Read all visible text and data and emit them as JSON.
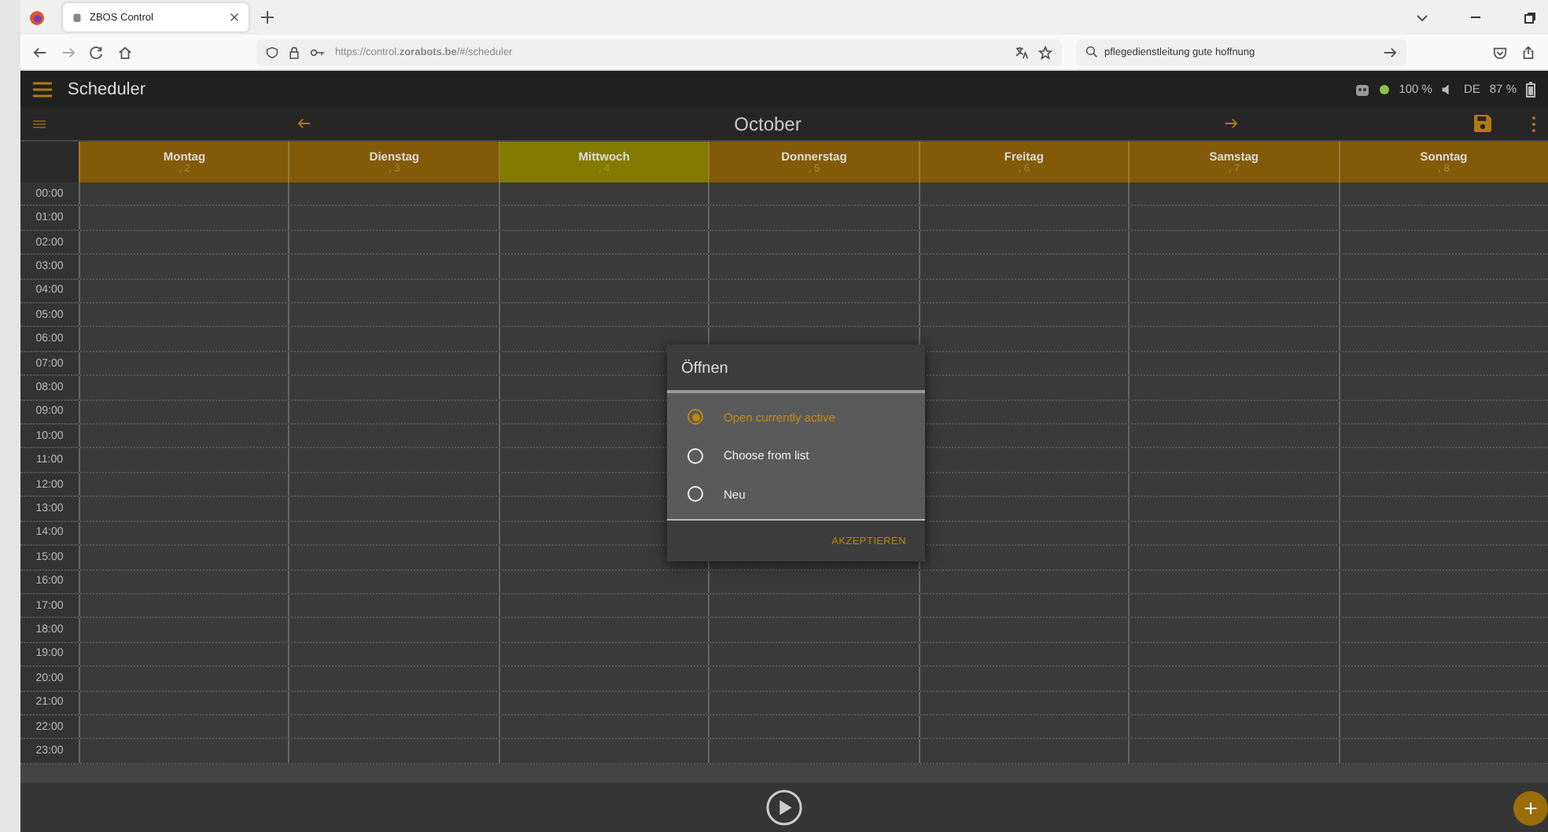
{
  "browser": {
    "tab_title": "ZBOS Control",
    "url": "https://control.**zorabots.be**/#/scheduler",
    "search": "pflegedienstleitung gute hoffnung"
  },
  "app": {
    "title": "Scheduler",
    "status": {
      "volume": "100 %",
      "language": "DE",
      "battery": "87 %"
    }
  },
  "calendar": {
    "month": "October",
    "days": [
      {
        "name": "Montag",
        "date": ", 2",
        "selected": false
      },
      {
        "name": "Dienstag",
        "date": ", 3",
        "selected": false
      },
      {
        "name": "Mittwoch",
        "date": ", 4",
        "selected": true
      },
      {
        "name": "Donnerstag",
        "date": ", 5",
        "selected": false
      },
      {
        "name": "Freitag",
        "date": ", 6",
        "selected": false
      },
      {
        "name": "Samstag",
        "date": ", 7",
        "selected": false
      },
      {
        "name": "Sonntag",
        "date": ", 8",
        "selected": false
      }
    ],
    "hours": [
      "00:00",
      "01:00",
      "02:00",
      "03:00",
      "04:00",
      "05:00",
      "06:00",
      "07:00",
      "08:00",
      "09:00",
      "10:00",
      "11:00",
      "12:00",
      "13:00",
      "14:00",
      "15:00",
      "16:00",
      "17:00",
      "18:00",
      "19:00",
      "20:00",
      "21:00",
      "22:00",
      "23:00"
    ]
  },
  "dialog": {
    "title": "Öffnen",
    "options": [
      {
        "label": "Open currently active",
        "selected": true
      },
      {
        "label": "Choose from list",
        "selected": false
      },
      {
        "label": "Neu",
        "selected": false
      }
    ],
    "button": "AKZEPTIEREN"
  }
}
